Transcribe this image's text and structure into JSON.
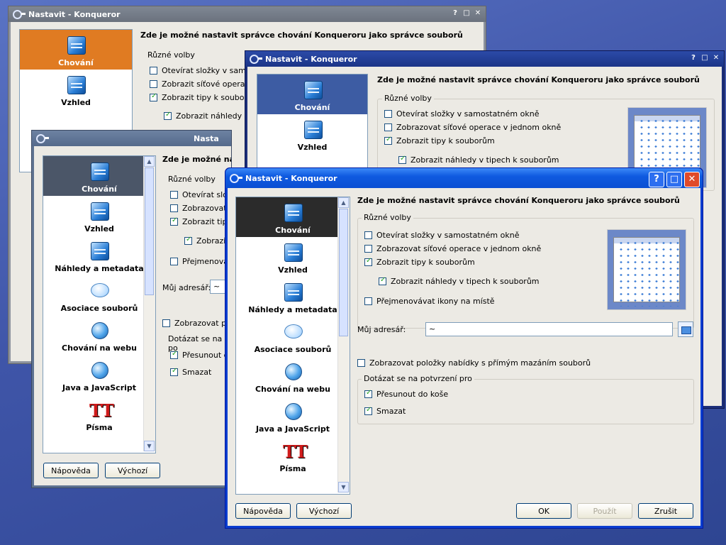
{
  "window_title": "Nastavit - Konqueror",
  "heading": "Zde je možné nastavit správce chování Konqueroru jako správce souborů",
  "group_misc": "Různé volby",
  "opt_open_folders": "Otevírat složky v samostatném okně",
  "opt_network_ops": "Zobrazovat síťové operace v jednom okně",
  "opt_tips": "Zobrazit tipy k souborům",
  "opt_preview_tips": "Zobrazit náhledy v tipech k souborům",
  "opt_rename": "Přejmenovávat ikony na místě",
  "home_label": "Můj adresář:",
  "home_value": "~",
  "opt_delete_menu": "Zobrazovat položky nabídky s přímým mazáním souborů",
  "group_confirm": "Dotázat se na potvrzení pro",
  "opt_trash": "Přesunout do koše",
  "opt_delete": "Smazat",
  "categories": [
    "Chování",
    "Vzhled",
    "Náhledy a metadata",
    "Asociace souborů",
    "Chování na webu",
    "Java a JavaScript",
    "Písma"
  ],
  "buttons": {
    "help": "Nápověda",
    "defaults": "Výchozí",
    "ok": "OK",
    "apply": "Použít",
    "cancel": "Zrušit"
  },
  "truncated": {
    "open": "Otevírat složky v samost",
    "net": "Zobrazit síťové opera",
    "tips": "Zobrazit tipy k souborům",
    "prev": "Zobrazit náhledy v ti",
    "open_s": "Otevírat slož",
    "net_s": "Zobrazovat",
    "tips_s": "Zobrazit tipy",
    "prev_s": "Zobrazit",
    "ren_s": "Přejmenováv",
    "delm_s": "Zobrazovat po",
    "conf_s": "Dotázat se na po",
    "trash_s": "Přesunout d",
    "win4_title": "Nasta",
    "help_s": "N"
  },
  "state": {
    "open_folders": false,
    "network_ops": false,
    "tips": true,
    "preview_tips": true,
    "rename": false,
    "delete_menu": false,
    "trash": true,
    "delete": true
  }
}
